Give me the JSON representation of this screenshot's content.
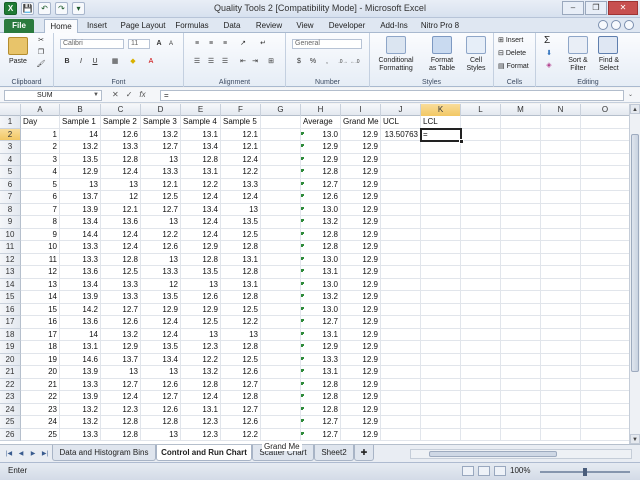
{
  "window": {
    "title": "Quality Tools 2  [Compatibility Mode]  -  Microsoft Excel",
    "qat_buttons": [
      "X",
      "💾",
      "↶",
      "↷",
      "▾"
    ],
    "controls": [
      "–",
      "❐",
      "✕"
    ]
  },
  "ribbon": {
    "tabs": [
      "File",
      "Home",
      "Insert",
      "Page Layout",
      "Formulas",
      "Data",
      "Review",
      "View",
      "Developer",
      "Add-Ins",
      "Nitro Pro 8"
    ],
    "active_tab": "Home",
    "groups": {
      "clipboard": {
        "label": "Clipboard",
        "paste": "Paste"
      },
      "font": {
        "label": "Font",
        "font_name": "Calibri",
        "font_size": "11",
        "bold": "B",
        "italic": "I",
        "underline": "U",
        "grow": "A",
        "shrink": "A"
      },
      "alignment": {
        "label": "Alignment"
      },
      "number": {
        "label": "Number",
        "format": "General",
        "currency": "$",
        "percent": "%",
        "comma": ","
      },
      "styles": {
        "label": "Styles",
        "conditional": "Conditional",
        "conditional2": "Formatting",
        "format_as": "Format",
        "format_as2": "as Table",
        "cell_styles": "Cell",
        "cell_styles2": "Styles"
      },
      "cells": {
        "label": "Cells",
        "insert": "Insert",
        "delete": "Delete",
        "format": "Format"
      },
      "editing": {
        "label": "Editing",
        "sum": "Σ",
        "sort": "Sort &",
        "sort2": "Filter",
        "find": "Find &",
        "find2": "Select"
      }
    }
  },
  "formula_bar": {
    "name_box": "SUM",
    "cancel": "✕",
    "enter": "✓",
    "fx": "fx",
    "formula": "="
  },
  "grid": {
    "columns": [
      "A",
      "B",
      "C",
      "D",
      "E",
      "F",
      "G",
      "H",
      "I",
      "J",
      "K",
      "L",
      "M",
      "N",
      "O"
    ],
    "selected_column": "K",
    "selected_row": 2,
    "row_numbers": [
      1,
      2,
      3,
      4,
      5,
      6,
      7,
      8,
      9,
      10,
      11,
      12,
      13,
      14,
      15,
      16,
      17,
      18,
      19,
      20,
      21,
      22,
      23,
      24,
      25,
      26
    ],
    "header_row": [
      "Day",
      "Sample 1",
      "Sample 2",
      "Sample 3",
      "Sample 4",
      "Sample 5",
      "",
      "Average",
      "Grand Me",
      "UCL",
      "LCL"
    ],
    "ucl_value": "13.50763",
    "active_cell_text": "=",
    "data": [
      [
        "1",
        "14",
        "12.6",
        "13.2",
        "13.1",
        "12.1",
        "13.0",
        "12.9"
      ],
      [
        "2",
        "13.2",
        "13.3",
        "12.7",
        "13.4",
        "12.1",
        "12.9",
        "12.9"
      ],
      [
        "3",
        "13.5",
        "12.8",
        "13",
        "12.8",
        "12.4",
        "12.9",
        "12.9"
      ],
      [
        "4",
        "12.9",
        "12.4",
        "13.3",
        "13.1",
        "12.2",
        "12.8",
        "12.9"
      ],
      [
        "5",
        "13",
        "13",
        "12.1",
        "12.2",
        "13.3",
        "12.7",
        "12.9"
      ],
      [
        "6",
        "13.7",
        "12",
        "12.5",
        "12.4",
        "12.4",
        "12.6",
        "12.9"
      ],
      [
        "7",
        "13.9",
        "12.1",
        "12.7",
        "13.4",
        "13",
        "13.0",
        "12.9"
      ],
      [
        "8",
        "13.4",
        "13.6",
        "13",
        "12.4",
        "13.5",
        "13.2",
        "12.9"
      ],
      [
        "9",
        "14.4",
        "12.4",
        "12.2",
        "12.4",
        "12.5",
        "12.8",
        "12.9"
      ],
      [
        "10",
        "13.3",
        "12.4",
        "12.6",
        "12.9",
        "12.8",
        "12.8",
        "12.9"
      ],
      [
        "11",
        "13.3",
        "12.8",
        "13",
        "12.8",
        "13.1",
        "13.0",
        "12.9"
      ],
      [
        "12",
        "13.6",
        "12.5",
        "13.3",
        "13.5",
        "12.8",
        "13.1",
        "12.9"
      ],
      [
        "13",
        "13.4",
        "13.3",
        "12",
        "13",
        "13.1",
        "13.0",
        "12.9"
      ],
      [
        "14",
        "13.9",
        "13.3",
        "13.5",
        "12.6",
        "12.8",
        "13.2",
        "12.9"
      ],
      [
        "15",
        "14.2",
        "12.7",
        "12.9",
        "12.9",
        "12.5",
        "13.0",
        "12.9"
      ],
      [
        "16",
        "13.6",
        "12.6",
        "12.4",
        "12.5",
        "12.2",
        "12.7",
        "12.9"
      ],
      [
        "17",
        "14",
        "13.2",
        "12.4",
        "13",
        "13",
        "13.1",
        "12.9"
      ],
      [
        "18",
        "13.1",
        "12.9",
        "13.5",
        "12.3",
        "12.8",
        "12.9",
        "12.9"
      ],
      [
        "19",
        "14.6",
        "13.7",
        "13.4",
        "12.2",
        "12.5",
        "13.3",
        "12.9"
      ],
      [
        "20",
        "13.9",
        "13",
        "13",
        "13.2",
        "12.6",
        "13.1",
        "12.9"
      ],
      [
        "21",
        "13.3",
        "12.7",
        "12.6",
        "12.8",
        "12.7",
        "12.8",
        "12.9"
      ],
      [
        "22",
        "13.9",
        "12.4",
        "12.7",
        "12.4",
        "12.8",
        "12.8",
        "12.9"
      ],
      [
        "23",
        "13.2",
        "12.3",
        "12.6",
        "13.1",
        "12.7",
        "12.8",
        "12.9"
      ],
      [
        "24",
        "13.2",
        "12.8",
        "12.8",
        "12.3",
        "12.6",
        "12.7",
        "12.9"
      ],
      [
        "25",
        "13.3",
        "12.8",
        "13",
        "12.3",
        "12.2",
        "12.7",
        "12.9"
      ]
    ],
    "row26": [
      "",
      "",
      "",
      "",
      "",
      "",
      "12.9"
    ]
  },
  "sheets": {
    "tabs": [
      "Data and Histogram Bins",
      "Control and Run Chart",
      "Scatter Chart",
      "Sheet2"
    ],
    "active": "Control and Run Chart",
    "tooltip": "Grand Me"
  },
  "status": {
    "mode": "Enter",
    "zoom": "100%"
  }
}
